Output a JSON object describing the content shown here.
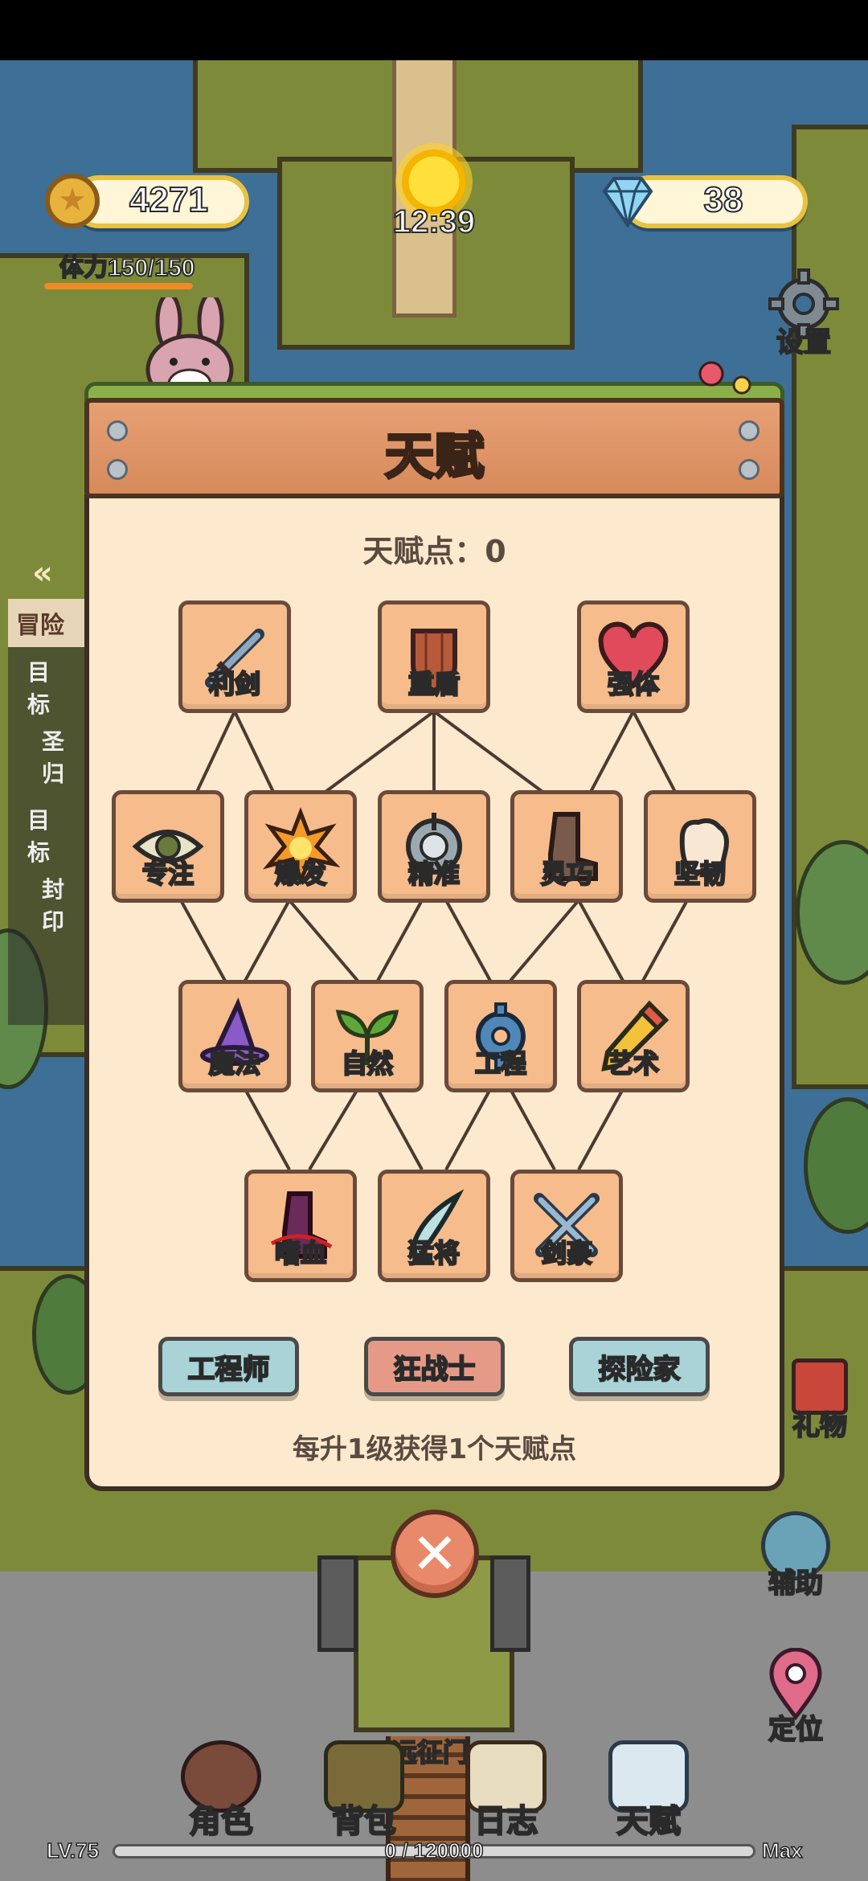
{
  "hud": {
    "coins": "4271",
    "gems": "38",
    "time": "12:39",
    "stamina_label": "体力",
    "stamina_value": "150/150",
    "settings_label": "设置"
  },
  "side_buttons": {
    "gift": "礼物",
    "assist": "辅助",
    "locate": "定位"
  },
  "quest_fragment": {
    "tab": "冒险",
    "line1": "目标",
    "line2": "圣归",
    "line3": "目标",
    "line4": "封印"
  },
  "map_sign": "远征门",
  "talent_panel": {
    "title": "天赋",
    "points_label": "天赋点：",
    "points_value": "0",
    "talents": {
      "row1": [
        "利剑",
        "重盾",
        "强体"
      ],
      "row2": [
        "专注",
        "爆发",
        "精准",
        "灵巧",
        "坚韧"
      ],
      "row3": [
        "魔法",
        "自然",
        "工程",
        "艺术"
      ],
      "row4": [
        "嗜血",
        "猛将",
        "剑豪"
      ]
    },
    "classes": [
      "工程师",
      "狂战士",
      "探险家"
    ],
    "class_colors": [
      "#a9d3d6",
      "#e59a88",
      "#a9d3d6"
    ],
    "footer": "每升1级获得1个天赋点"
  },
  "bottom_nav": {
    "items": [
      "角色",
      "背包",
      "日志",
      "天赋"
    ]
  },
  "xp": {
    "level": "LV.75",
    "progress": "0 / 120000",
    "max": "Max"
  }
}
